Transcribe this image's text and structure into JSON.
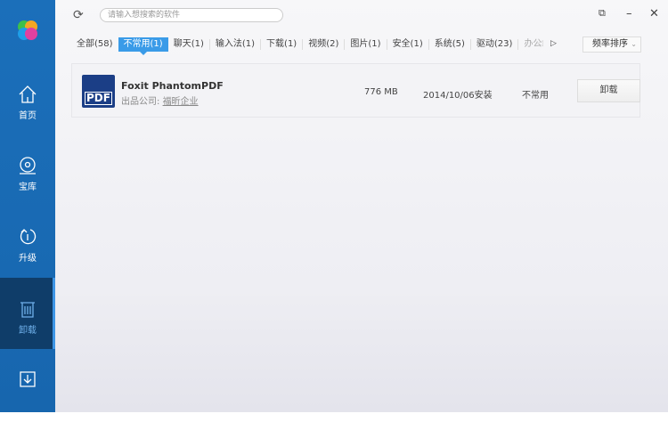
{
  "sidebar": {
    "items": [
      {
        "label": "首页"
      },
      {
        "label": "宝库"
      },
      {
        "label": "升级"
      },
      {
        "label": "卸载"
      },
      {
        "label": ""
      }
    ]
  },
  "topbar": {
    "search_placeholder": "请输入想搜索的软件"
  },
  "tabs": [
    {
      "label": "全部(58)"
    },
    {
      "label": "不常用(1)"
    },
    {
      "label": "聊天(1)"
    },
    {
      "label": "输入法(1)"
    },
    {
      "label": "下载(1)"
    },
    {
      "label": "视频(2)"
    },
    {
      "label": "图片(1)"
    },
    {
      "label": "安全(1)"
    },
    {
      "label": "系统(5)"
    },
    {
      "label": "驱动(23)"
    },
    {
      "label": "办公"
    }
  ],
  "sort_label": "频率排序",
  "apps": [
    {
      "name": "Foxit PhantomPDF",
      "company_label": "出品公司:",
      "company": "福昕企业",
      "size": "776 MB",
      "installed": "2014/10/06安装",
      "usage": "不常用",
      "action": "卸载",
      "icon_text": "PDF"
    }
  ],
  "colors": {
    "sidebar": "#1b6fba",
    "accent": "#3a9be8"
  }
}
